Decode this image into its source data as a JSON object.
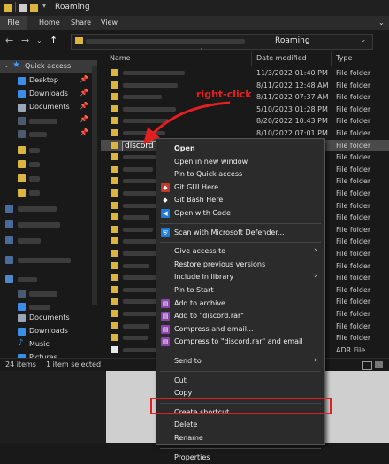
{
  "window": {
    "title": "Roaming"
  },
  "ribbon": {
    "tabs": [
      "File",
      "Home",
      "Share",
      "View"
    ]
  },
  "address": {
    "path_end": "Roaming"
  },
  "columns": {
    "name": "Name",
    "date": "Date modified",
    "type": "Type"
  },
  "nav": {
    "quick_access": "Quick access",
    "items": [
      {
        "label": "Desktop",
        "icon": "desktop-icon",
        "pinned": true
      },
      {
        "label": "Downloads",
        "icon": "downloads-icon",
        "pinned": true
      },
      {
        "label": "Documents",
        "icon": "documents-icon",
        "pinned": true
      },
      {
        "label": "Documents",
        "icon": "documents-icon",
        "pinned": false
      },
      {
        "label": "Downloads",
        "icon": "downloads-icon",
        "pinned": false
      },
      {
        "label": "Music",
        "icon": "music-icon",
        "pinned": false
      },
      {
        "label": "Pictures",
        "icon": "pictures-icon",
        "pinned": false
      }
    ]
  },
  "files": [
    {
      "date": "11/3/2022 01:40 PM",
      "type": "File folder"
    },
    {
      "date": "8/11/2022 12:48 AM",
      "type": "File folder"
    },
    {
      "date": "8/11/2022 07:37 AM",
      "type": "File folder"
    },
    {
      "date": "5/10/2023 01:28 PM",
      "type": "File folder"
    },
    {
      "date": "8/20/2022 10:43 PM",
      "type": "File folder"
    },
    {
      "date": "8/10/2022 07:01 PM",
      "type": "File folder"
    },
    {
      "name": "discord",
      "date": "",
      "type": "File folder"
    },
    {
      "date": "",
      "type": "File folder"
    },
    {
      "date": "",
      "type": "File folder"
    },
    {
      "date": "",
      "type": "File folder"
    },
    {
      "date": "",
      "type": "File folder"
    },
    {
      "date": "",
      "type": "File folder"
    },
    {
      "date": "",
      "type": "File folder"
    },
    {
      "date": "",
      "type": "File folder"
    },
    {
      "date": "",
      "type": "File folder"
    },
    {
      "date": "",
      "type": "File folder"
    },
    {
      "date": "",
      "type": "File folder"
    },
    {
      "date": "",
      "type": "File folder"
    },
    {
      "date": "",
      "type": "File folder"
    },
    {
      "date": "",
      "type": "File folder"
    },
    {
      "date": "",
      "type": "File folder"
    },
    {
      "date": "",
      "type": "File folder"
    },
    {
      "date": "",
      "type": "File folder"
    },
    {
      "date": "",
      "type": "ADR File"
    }
  ],
  "status": {
    "items": "24 items",
    "selected": "1 item selected"
  },
  "annotation": {
    "label": "right-click",
    "color": "#e32020"
  },
  "context_menu": {
    "items": [
      {
        "label": "Open",
        "bold": true
      },
      {
        "label": "Open in new window"
      },
      {
        "label": "Pin to Quick access"
      },
      {
        "label": "Git GUI Here",
        "icon": "git-gui-icon"
      },
      {
        "label": "Git Bash Here",
        "icon": "git-bash-icon"
      },
      {
        "label": "Open with Code",
        "icon": "vscode-icon"
      },
      {
        "sep": true
      },
      {
        "label": "Scan with Microsoft Defender...",
        "icon": "defender-icon"
      },
      {
        "sep": true
      },
      {
        "label": "Give access to",
        "submenu": true
      },
      {
        "label": "Restore previous versions"
      },
      {
        "label": "Include in library",
        "submenu": true
      },
      {
        "label": "Pin to Start"
      },
      {
        "label": "Add to archive...",
        "icon": "winrar-icon"
      },
      {
        "label": "Add to \"discord.rar\"",
        "icon": "winrar-icon"
      },
      {
        "label": "Compress and email...",
        "icon": "winrar-icon"
      },
      {
        "label": "Compress to \"discord.rar\" and email",
        "icon": "winrar-icon"
      },
      {
        "sep": true
      },
      {
        "label": "Send to",
        "submenu": true
      },
      {
        "sep": true
      },
      {
        "label": "Cut"
      },
      {
        "label": "Copy"
      },
      {
        "sep": true
      },
      {
        "label": "Create shortcut"
      },
      {
        "label": "Delete",
        "highlighted": true
      },
      {
        "label": "Rename"
      },
      {
        "sep": true
      },
      {
        "label": "Properties"
      }
    ]
  },
  "colors": {
    "folder": "#dcb441",
    "highlight": "#e02020",
    "accent": "#1e7bd6"
  }
}
